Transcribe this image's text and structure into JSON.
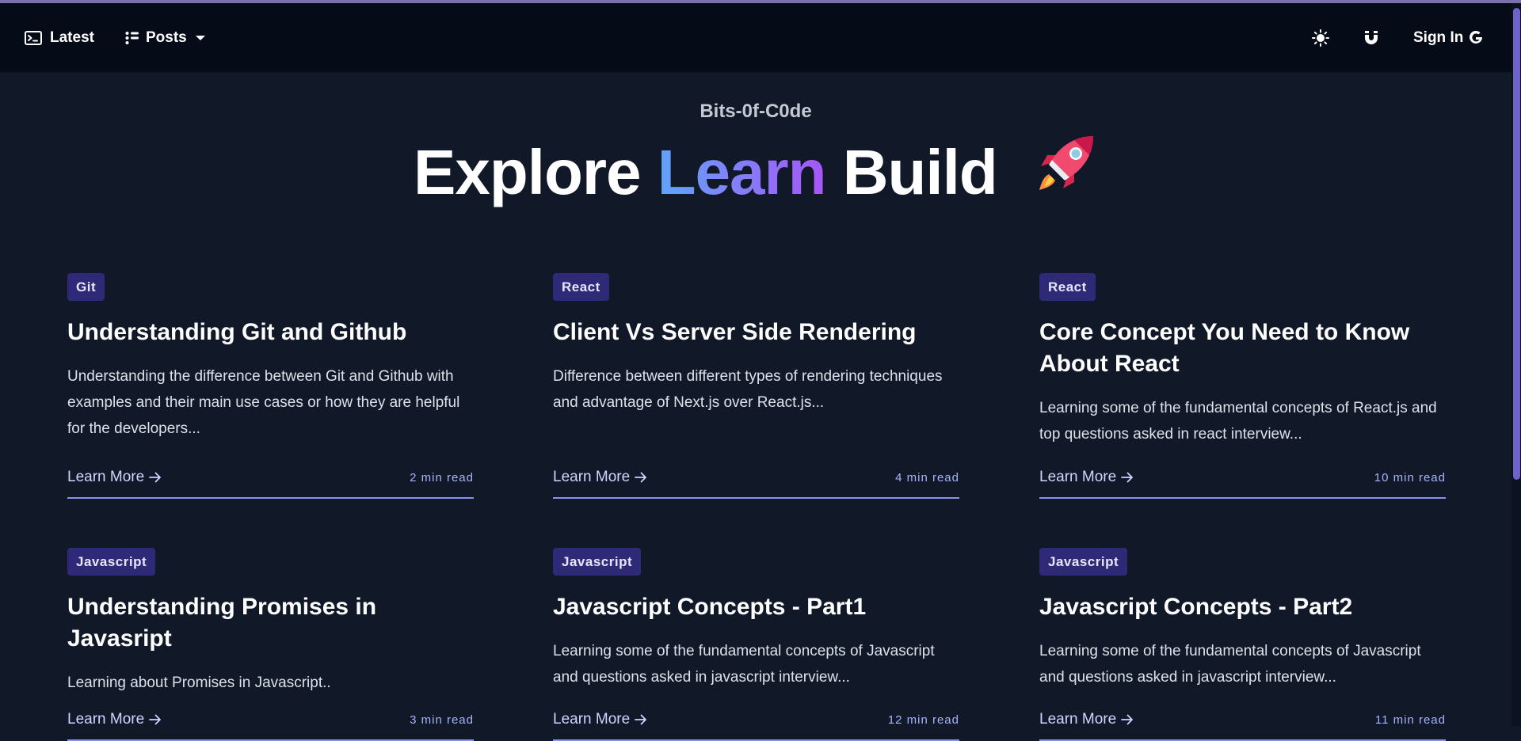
{
  "nav": {
    "latest_label": "Latest",
    "posts_label": "Posts",
    "signin_label": "Sign In",
    "icons": [
      "terminal-icon",
      "list-icon",
      "chevron-down-icon",
      "sun-icon",
      "magnet-icon",
      "google-icon"
    ]
  },
  "hero": {
    "subtitle": "Bits-0f-C0de",
    "title_start": "Explore",
    "title_highlight": "Learn",
    "title_end": "Build",
    "rocket_icon": "rocket-icon"
  },
  "colors": {
    "background": "#111827",
    "navbar": "#050b17",
    "tag_bg": "#2e2a78",
    "gradient_start": "#60a5fa",
    "gradient_end": "#a855f7",
    "underline": "#8b93e6"
  },
  "cards": [
    {
      "tag": "Git",
      "title": "Understanding Git and Github",
      "description": "Understanding the difference between Git and Github with examples and their main use cases or how they are helpful for the developers...",
      "link": "Learn More",
      "read_time": "2 min read"
    },
    {
      "tag": "React",
      "title": "Client Vs Server Side Rendering",
      "description": "Difference between different types of rendering techniques and advantage of Next.js over React.js...",
      "link": "Learn More",
      "read_time": "4 min read"
    },
    {
      "tag": "React",
      "title": "Core Concept You Need to Know About React",
      "description": "Learning some of the fundamental concepts of React.js and top questions asked in react interview...",
      "link": "Learn More",
      "read_time": "10 min read"
    },
    {
      "tag": "Javascript",
      "title": "Understanding Promises in Javasript",
      "description": "Learning about Promises in Javascript..",
      "link": "Learn More",
      "read_time": "3 min read"
    },
    {
      "tag": "Javascript",
      "title": "Javascript Concepts - Part1",
      "description": "Learning some of the fundamental concepts of Javascript and questions asked in javascript interview...",
      "link": "Learn More",
      "read_time": "12 min read"
    },
    {
      "tag": "Javascript",
      "title": "Javascript Concepts - Part2",
      "description": "Learning some of the fundamental concepts of Javascript and questions asked in javascript interview...",
      "link": "Learn More",
      "read_time": "11 min read"
    }
  ]
}
